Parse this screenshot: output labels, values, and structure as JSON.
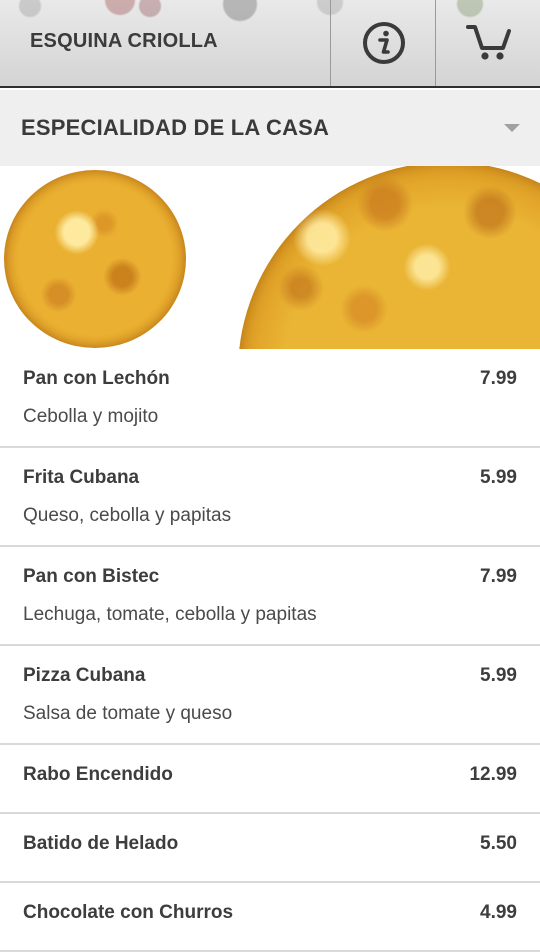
{
  "header": {
    "title": "ESQUINA CRIOLLA",
    "info_icon": "info-circle-icon",
    "cart_icon": "shopping-cart-icon"
  },
  "category": {
    "selected": "ESPECIALIDAD DE LA CASA",
    "icon": "caret-down-icon"
  },
  "menu": {
    "items": [
      {
        "name": "Pan con Lechón",
        "price": "7.99",
        "description": "Cebolla y mojito"
      },
      {
        "name": "Frita Cubana",
        "price": "5.99",
        "description": "Queso, cebolla y papitas"
      },
      {
        "name": "Pan con Bistec",
        "price": "7.99",
        "description": "Lechuga, tomate, cebolla y papitas"
      },
      {
        "name": "Pizza Cubana",
        "price": "5.99",
        "description": "Salsa de tomate y queso"
      },
      {
        "name": "Rabo Encendido",
        "price": "12.99",
        "description": ""
      },
      {
        "name": "Batido de Helado",
        "price": "5.50",
        "description": ""
      },
      {
        "name": "Chocolate con Churros",
        "price": "4.99",
        "description": ""
      }
    ]
  },
  "colors": {
    "text": "#3d3d3d",
    "category_bg": "#efefef",
    "divider": "#d9d9d9"
  }
}
